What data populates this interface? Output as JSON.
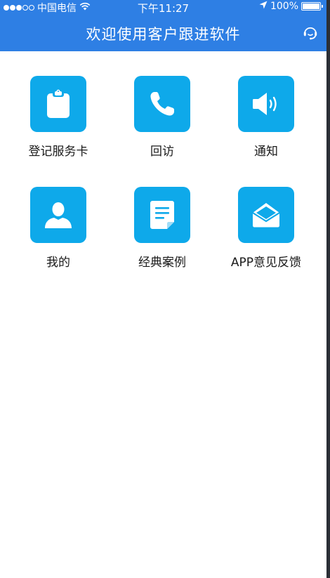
{
  "status_bar": {
    "carrier": "中国电信",
    "time": "下午11:27",
    "battery": "100%",
    "battery_level": 1.0,
    "signal_bars_filled": 3,
    "signal_bars_total": 5
  },
  "header": {
    "title": "欢迎使用客户跟进软件",
    "action_icon": "support-face-icon"
  },
  "menu": {
    "items": [
      {
        "label": "登记服务卡",
        "icon": "clipboard-icon"
      },
      {
        "label": "回访",
        "icon": "phone-icon"
      },
      {
        "label": "通知",
        "icon": "speaker-icon"
      },
      {
        "label": "我的",
        "icon": "user-icon"
      },
      {
        "label": "经典案例",
        "icon": "document-icon"
      },
      {
        "label": "APP意见反馈",
        "icon": "envelope-icon"
      }
    ]
  },
  "colors": {
    "header_blue": "#2e7fe4",
    "tile_blue": "#0ea9ea",
    "background": "#ffffff"
  }
}
